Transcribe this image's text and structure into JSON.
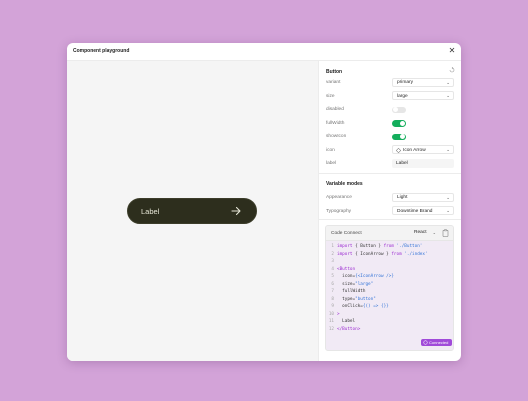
{
  "window": {
    "title": "Component playground"
  },
  "preview": {
    "button_label": "Label"
  },
  "panel": {
    "section_title": "Button",
    "props": {
      "variant": {
        "label": "variant",
        "value": "primary"
      },
      "size": {
        "label": "size",
        "value": "large"
      },
      "disabled": {
        "label": "disabled",
        "on": false
      },
      "fullWidth": {
        "label": "fullWidth",
        "on": true
      },
      "showIcon": {
        "label": "showIcon",
        "on": true
      },
      "icon": {
        "label": "icon",
        "value": "Icon Arrow"
      },
      "label": {
        "label": "label",
        "value": "Label"
      }
    },
    "variable_modes": {
      "title": "Variable modes",
      "appearance": {
        "label": "Appearance",
        "value": "Light"
      },
      "typography": {
        "label": "Typography",
        "value": "Downtime Brand"
      }
    }
  },
  "code_connect": {
    "title": "Code Connect",
    "language": "React",
    "lines": [
      {
        "n": "1",
        "segments": [
          {
            "t": "import",
            "c": "kw"
          },
          {
            "t": " { Button } ",
            "c": "plain"
          },
          {
            "t": "from",
            "c": "kw"
          },
          {
            "t": " './Button'",
            "c": "str"
          }
        ]
      },
      {
        "n": "2",
        "segments": [
          {
            "t": "import",
            "c": "kw"
          },
          {
            "t": " { IconArrow } ",
            "c": "plain"
          },
          {
            "t": "from",
            "c": "kw"
          },
          {
            "t": " './index'",
            "c": "str"
          }
        ]
      },
      {
        "n": "3",
        "segments": []
      },
      {
        "n": "4",
        "segments": [
          {
            "t": "<Button",
            "c": "tag"
          }
        ]
      },
      {
        "n": "5",
        "segments": [
          {
            "t": "  icon=",
            "c": "attr"
          },
          {
            "t": "{<IconArrow />}",
            "c": "str"
          }
        ]
      },
      {
        "n": "6",
        "segments": [
          {
            "t": "  size=",
            "c": "attr"
          },
          {
            "t": "\"large\"",
            "c": "str"
          }
        ]
      },
      {
        "n": "7",
        "segments": [
          {
            "t": "  fullWidth",
            "c": "attr"
          }
        ]
      },
      {
        "n": "8",
        "segments": [
          {
            "t": "  type=",
            "c": "attr"
          },
          {
            "t": "\"button\"",
            "c": "str"
          }
        ]
      },
      {
        "n": "9",
        "segments": [
          {
            "t": "  onClick=",
            "c": "attr"
          },
          {
            "t": "{() => {}}",
            "c": "str"
          }
        ]
      },
      {
        "n": "10",
        "segments": [
          {
            "t": ">",
            "c": "tag"
          }
        ]
      },
      {
        "n": "11",
        "segments": [
          {
            "t": "  Label",
            "c": "plain"
          }
        ]
      },
      {
        "n": "12",
        "segments": [
          {
            "t": "</Button>",
            "c": "tag"
          }
        ]
      }
    ],
    "status": "Connected"
  },
  "colors": {
    "background": "#d3a3d8",
    "toggle_on": "#14ae5c",
    "toggle_off": "#e6e6e6",
    "button_bg": "#2d2e1d",
    "connected": "#a04ad9"
  }
}
